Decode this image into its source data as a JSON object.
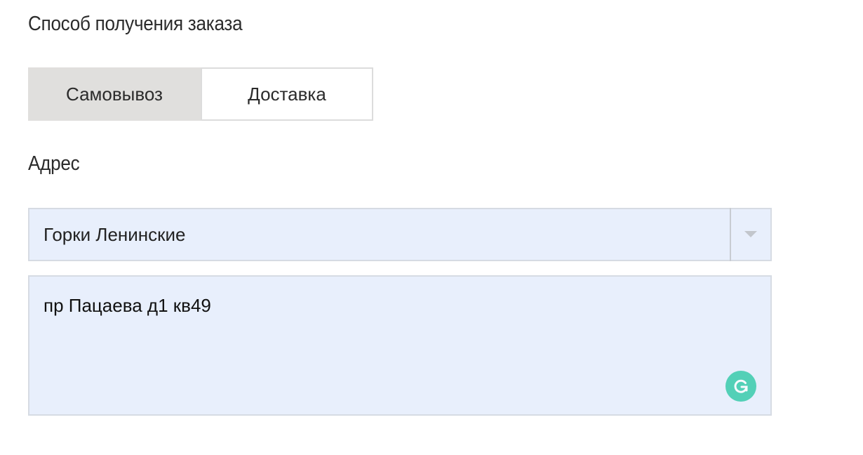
{
  "delivery": {
    "title": "Способ получения заказа",
    "options": [
      {
        "label": "Самовывоз",
        "selected": true
      },
      {
        "label": "Доставка",
        "selected": false
      }
    ]
  },
  "address": {
    "title": "Адрес",
    "city_select": {
      "value": "Горки Ленинские",
      "icon": "chevron-down-icon"
    },
    "street_field": {
      "value": "пр Пацаева д1 кв49"
    },
    "grammarly_icon": "grammarly-icon"
  },
  "colors": {
    "toggle_active_bg": "#e0dfdd",
    "field_bg": "#e8effc",
    "grammarly_green": "#15c39a"
  }
}
